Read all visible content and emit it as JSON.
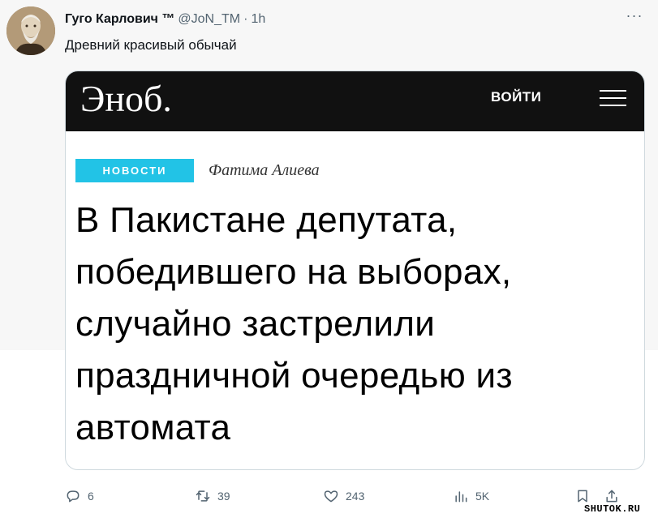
{
  "tweet": {
    "author_name": "Гуго Карлович ™",
    "author_handle": "@JoN_TM",
    "separator": "·",
    "time": "1h",
    "text": "Древний красивый обычай",
    "more_label": "···"
  },
  "card": {
    "site_logo": "Эноб.",
    "login_label": "ВОЙТИ",
    "badge": "НОВОСТИ",
    "byline": "Фатима Алиева",
    "headline": "В Пакистане депутата, победившего на выборах, случайно застрелили праздничной очередью из автомата",
    "accent_color": "#22c3e6",
    "bar_color": "#111111"
  },
  "actions": {
    "reply_count": "6",
    "retweet_count": "39",
    "like_count": "243",
    "views_count": "5K"
  },
  "icons": [
    "reply-icon",
    "retweet-icon",
    "like-icon",
    "views-icon",
    "bookmark-icon",
    "share-icon",
    "menu-icon"
  ],
  "watermark": "SHUTOK.RU"
}
